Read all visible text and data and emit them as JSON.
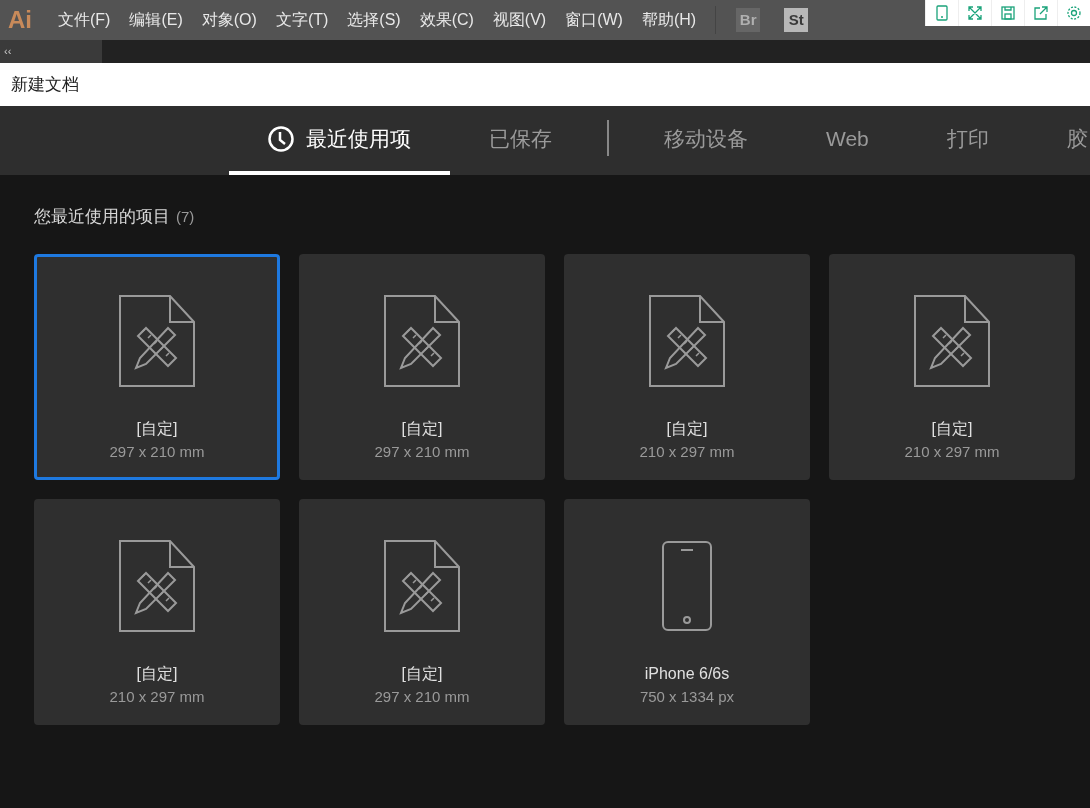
{
  "app_logo": "Ai",
  "menu": [
    "文件(F)",
    "编辑(E)",
    "对象(O)",
    "文字(T)",
    "选择(S)",
    "效果(C)",
    "视图(V)",
    "窗口(W)",
    "帮助(H)"
  ],
  "app_switchers": [
    {
      "label": "Br",
      "disabled": true
    },
    {
      "label": "St",
      "disabled": false
    }
  ],
  "panel_toggle": "‹‹",
  "dialog": {
    "title": "新建文档",
    "tabs": [
      {
        "kind": "icon_tab",
        "label": "最近使用项",
        "selected": true
      },
      {
        "kind": "tab",
        "label": "已保存",
        "selected": false
      },
      {
        "kind": "separator"
      },
      {
        "kind": "tab",
        "label": "移动设备",
        "selected": false
      },
      {
        "kind": "tab",
        "label": "Web",
        "selected": false
      },
      {
        "kind": "tab",
        "label": "打印",
        "selected": false
      },
      {
        "kind": "tab",
        "label": "胶",
        "selected": false
      }
    ],
    "section_title": "您最近使用的项目",
    "section_count": "(7)",
    "presets": [
      {
        "kind": "document",
        "name": "[自定]",
        "size": "297 x 210 mm",
        "selected": true
      },
      {
        "kind": "document",
        "name": "[自定]",
        "size": "297 x 210 mm",
        "selected": false
      },
      {
        "kind": "document",
        "name": "[自定]",
        "size": "210 x 297 mm",
        "selected": false
      },
      {
        "kind": "document",
        "name": "[自定]",
        "size": "210 x 297 mm",
        "selected": false
      },
      {
        "kind": "document",
        "name": "[自定]",
        "size": "210 x 297 mm",
        "selected": false
      },
      {
        "kind": "document",
        "name": "[自定]",
        "size": "297 x 210 mm",
        "selected": false
      },
      {
        "kind": "phone",
        "name": "iPhone 6/6s",
        "size": "750 x 1334 px",
        "selected": false
      }
    ]
  }
}
